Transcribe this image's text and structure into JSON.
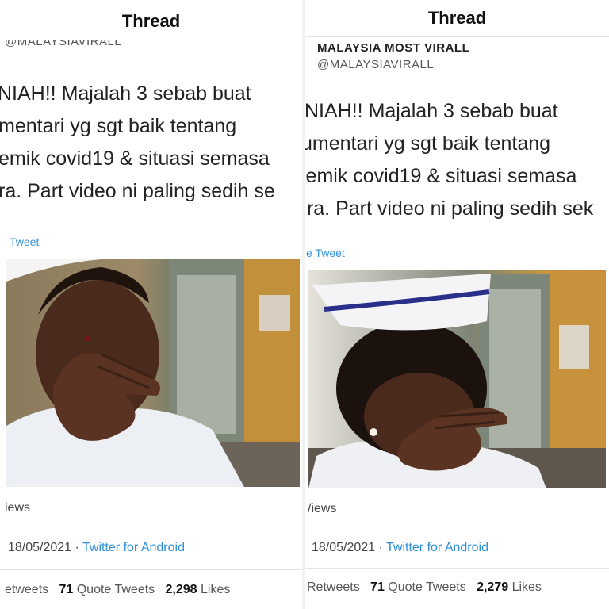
{
  "left": {
    "header_title": "Thread",
    "account_name": "",
    "account_handle": "@MALAYSIAVIRALL",
    "tweet_lines": [
      "NIAH!! Majalah 3 sebab buat",
      "mentari yg sgt baik tentang",
      "emik covid19 & situasi semasa",
      "ra. Part video ni paling sedih se"
    ],
    "quote_link": "Tweet",
    "views_label": "iews",
    "date": "18/05/2021",
    "separator": "·",
    "client": "Twitter for Android",
    "retweets_label": "etweets",
    "quote_count": "71",
    "quote_label": "Quote Tweets",
    "likes_count": "2,298",
    "likes_label": "Likes"
  },
  "right": {
    "header_title": "Thread",
    "account_name": "MALAYSIA MOST VIRALL",
    "account_handle": "@MALAYSIAVIRALL",
    "tweet_lines": [
      "NIAH!! Majalah 3 sebab buat",
      "umentari yg sgt baik tentang",
      "lemik covid19 & situasi semasa",
      "ıra. Part video ni paling sedih sek"
    ],
    "quote_link": "e Tweet",
    "views_label": "/iews",
    "date": "18/05/2021",
    "separator": "·",
    "client": "Twitter for Android",
    "retweets_label": "Retweets",
    "quote_count": "71",
    "quote_label": "Quote Tweets",
    "likes_count": "2,279",
    "likes_label": "Likes"
  },
  "colors": {
    "link": "#2f8fd8",
    "text": "#222222",
    "muted": "#555555"
  }
}
